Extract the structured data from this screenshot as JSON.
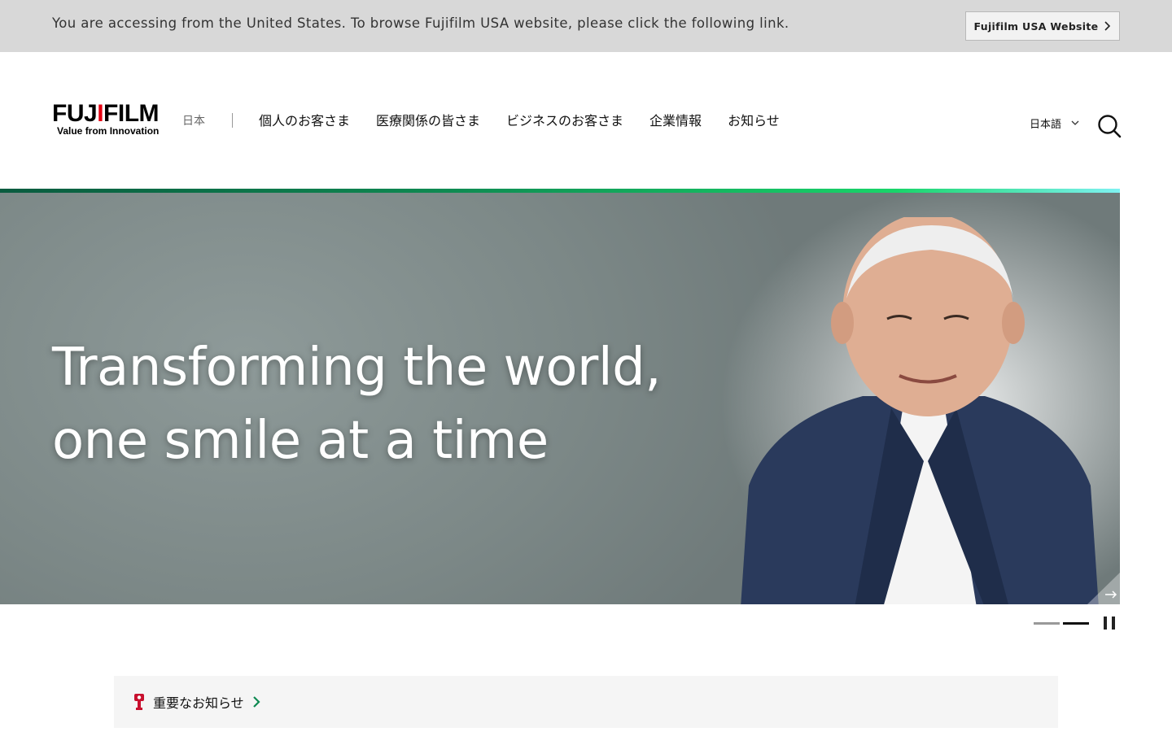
{
  "geo_banner": {
    "message": "You are accessing from the United States. To browse Fujifilm USA website, please click the following link.",
    "button_label": "Fujifilm USA Website"
  },
  "header": {
    "logo_text": "FUJIFILM",
    "logo_tagline": "Value from Innovation",
    "region": "日本",
    "nav": [
      {
        "label": "個人のお客さま"
      },
      {
        "label": "医療関係の皆さま"
      },
      {
        "label": "ビジネスのお客さま"
      },
      {
        "label": "企業情報"
      },
      {
        "label": "お知らせ"
      }
    ],
    "language": "日本語"
  },
  "hero": {
    "headline_line1": "Transforming the world,",
    "headline_line2": "one smile at a time",
    "stripe_colors": [
      "#0a5b3f",
      "#19d56a",
      "#7ff2f2"
    ]
  },
  "carousel": {
    "slide_count": 2,
    "active_index": 1
  },
  "notice": {
    "label": "重要なお知らせ",
    "icon_color": "#c8102e"
  },
  "colors": {
    "accent_green": "#0f8a52",
    "logo_red": "#e60012"
  }
}
